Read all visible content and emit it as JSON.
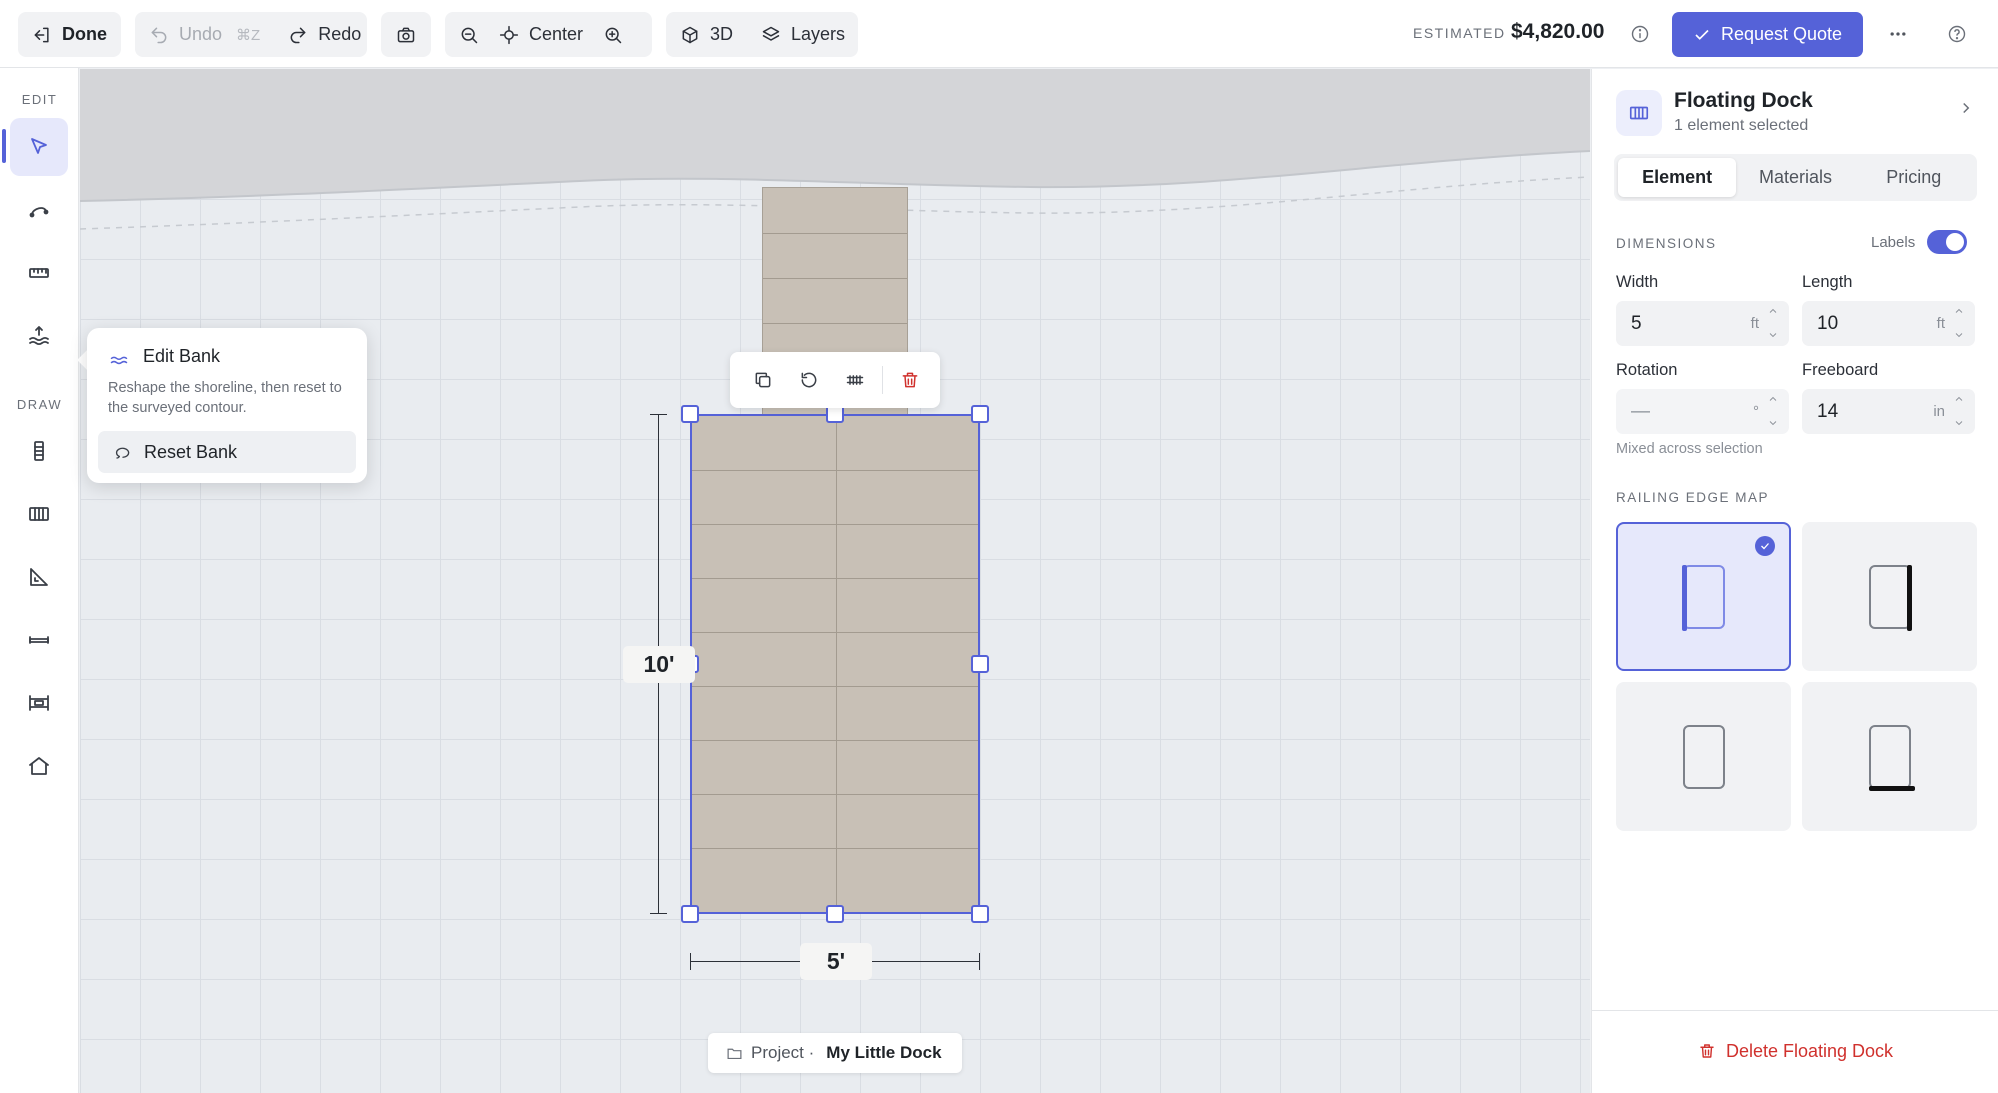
{
  "toolbar": {
    "done_label": "Done",
    "undo_label": "Undo",
    "undo_shortcut": "⌘Z",
    "redo_label": "Redo",
    "center_label": "Center",
    "view3d_label": "3D",
    "layers_label": "Layers",
    "estimated_label": "ESTIMATED",
    "estimated_value": "$4,820.00",
    "request_quote_label": "Request Quote"
  },
  "rail": {
    "edit_label": "EDIT",
    "draw_label": "DRAW"
  },
  "popover": {
    "title": "Edit Bank",
    "description": "Reshape the shoreline, then reset to the surveyed contour.",
    "reset_label": "Reset Bank"
  },
  "canvas": {
    "height_dim": "10'",
    "width_dim": "5'",
    "project_label": "Project ·",
    "project_name": "My Little Dock"
  },
  "panel": {
    "title": "Floating Dock",
    "subtitle": "1 element selected",
    "tabs": [
      {
        "label": "Element",
        "active": true
      },
      {
        "label": "Materials",
        "active": false
      },
      {
        "label": "Pricing",
        "active": false
      }
    ],
    "dimensions_label": "DIMENSIONS",
    "labels_toggle_label": "Labels",
    "labels_toggle_on": true,
    "width": {
      "label": "Width",
      "value": "5",
      "unit": "ft"
    },
    "length": {
      "label": "Length",
      "value": "10",
      "unit": "ft"
    },
    "rotation": {
      "label": "Rotation",
      "value": "—",
      "unit": "°"
    },
    "freeboard": {
      "label": "Freeboard",
      "value": "14",
      "unit": "in"
    },
    "mixed_hint": "Mixed across selection",
    "railing_label": "RAILING EDGE MAP",
    "railing_options": [
      {
        "edge": "left",
        "selected": true
      },
      {
        "edge": "right",
        "selected": false
      },
      {
        "edge": "none",
        "selected": false
      },
      {
        "edge": "bottom",
        "selected": false
      }
    ],
    "delete_label": "Delete Floating Dock"
  },
  "colors": {
    "accent": "#5562d8",
    "danger": "#d0312d",
    "deck": "#c8c0b6",
    "bank": "#d4d5d8"
  }
}
